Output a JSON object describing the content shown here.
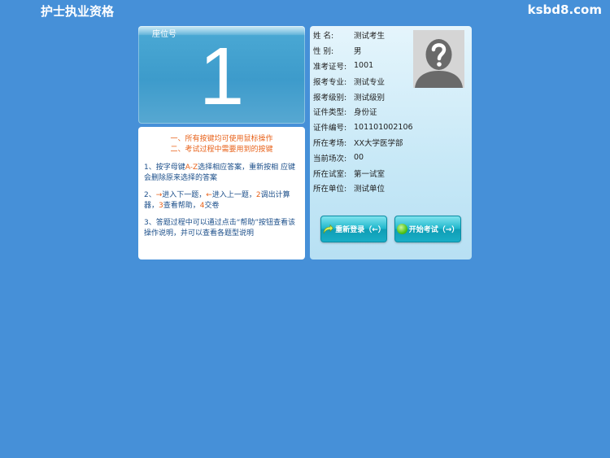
{
  "header": {
    "title": "护士执业资格",
    "site": "ksbd8.com"
  },
  "seat": {
    "label": "座位号",
    "number": "1"
  },
  "tips": {
    "head_line1": "一、所有按键均可使用鼠标操作",
    "head_line2": "二、考试过程中需要用到的按键",
    "tip1": {
      "p1": "1、按字母键",
      "key": "A-Z",
      "p2": "选择相应答案，重新按相 应键会删除原来选择的答案"
    },
    "tip2": {
      "p1": "2、",
      "k1": "→",
      "p2": "进入下一题，",
      "k2": "←",
      "p3": "进入上一题，",
      "k3": "2",
      "p4": "调出计算器，",
      "k4": "3",
      "p5": "查看帮助，",
      "k5": "4",
      "p6": "交卷"
    },
    "tip3": "3、答题过程中可以通过点击“帮助”按钮查看该操作说明，并可以查看各题型说明"
  },
  "info": {
    "rows": [
      {
        "label": "姓  名:",
        "value": "测试考生"
      },
      {
        "label": "性  别:",
        "value": "男"
      },
      {
        "label": "准考证号:",
        "value": "1001"
      },
      {
        "label": "报考专业:",
        "value": "测试专业"
      },
      {
        "label": "报考级别:",
        "value": "测试级别"
      },
      {
        "label": "证件类型:",
        "value": "身份证"
      },
      {
        "label": "证件编号:",
        "value": "101101002106"
      },
      {
        "label": "所在考场:",
        "value": "XX大学医学部"
      },
      {
        "label": "当前场次:",
        "value": "00"
      },
      {
        "label": "所在试室:",
        "value": "第一试室"
      },
      {
        "label": "所在单位:",
        "value": "测试单位"
      }
    ],
    "photo_icon": "unknown-person-icon"
  },
  "buttons": {
    "relogin": "重新登录（←）",
    "start": "开始考试（→）"
  },
  "colors": {
    "background": "#4690d8",
    "highlight": "#e8621a",
    "button": "#1fb7cc"
  }
}
